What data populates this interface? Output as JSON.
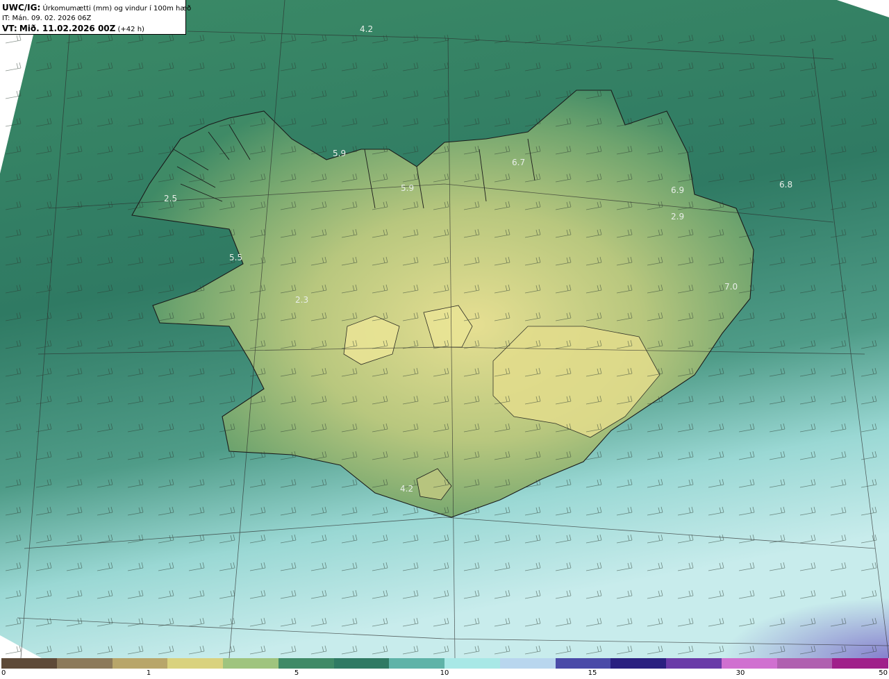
{
  "header": {
    "model": "UWC/IG:",
    "title": "Úrkomumætti (mm) og vindur í 100m hæð",
    "init_time": "IT: Mán. 09. 02. 2026 06Z",
    "valid_prefix": "VT:",
    "valid_time": "Mið. 11.02.2026 00Z",
    "lead": "(+42 h)"
  },
  "map_labels": [
    "4.2",
    "5.9",
    "5.9",
    "6.7",
    "6.8",
    "6.9",
    "2.9",
    "2.5",
    "5.5",
    "2.3",
    "7.0",
    "4.2"
  ],
  "colorbar": {
    "ticks": [
      "0",
      "1",
      "5",
      "10",
      "15",
      "30",
      "50"
    ],
    "colors": [
      "#5e4a38",
      "#8c7a5a",
      "#b8a66a",
      "#d9d27e",
      "#9fc47e",
      "#3f8a66",
      "#2f7a63",
      "#5fb3a8",
      "#a8e8e6",
      "#b8d6ee",
      "#4a4aa8",
      "#2a2080",
      "#6a3aa8",
      "#d070d0",
      "#b060b0",
      "#a0208a"
    ]
  },
  "colors": {
    "sea_dark": "#2f7a63",
    "sea_light": "#bfe9ea",
    "land_low": "#5e9a6a",
    "land_high": "#dad88a"
  }
}
